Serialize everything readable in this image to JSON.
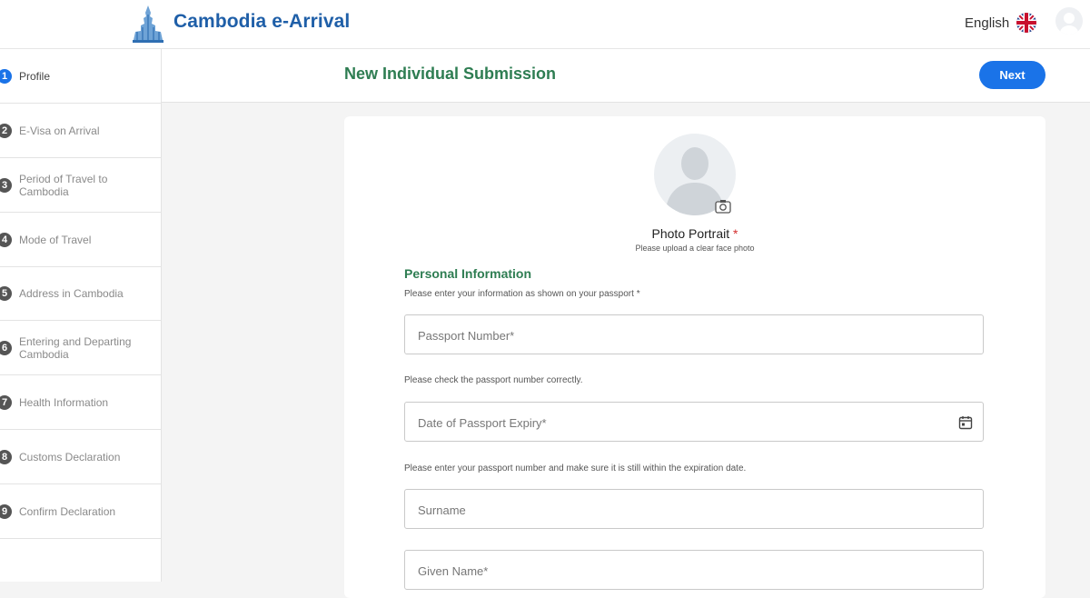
{
  "header": {
    "brand": "Cambodia e-Arrival",
    "language": "English",
    "icons": {
      "logo": "angkor-logo-icon",
      "flag": "uk-flag-icon",
      "user": "user-avatar-icon"
    }
  },
  "sidebar": {
    "steps": [
      {
        "number": "1",
        "label": "Profile",
        "active": true
      },
      {
        "number": "2",
        "label": "E-Visa on Arrival"
      },
      {
        "number": "3",
        "label": "Period of Travel to Cambodia"
      },
      {
        "number": "4",
        "label": "Mode of Travel"
      },
      {
        "number": "5",
        "label": "Address in Cambodia"
      },
      {
        "number": "6",
        "label": "Entering and Departing Cambodia"
      },
      {
        "number": "7",
        "label": "Health Information"
      },
      {
        "number": "8",
        "label": "Customs Declaration"
      },
      {
        "number": "9",
        "label": "Confirm Declaration"
      }
    ]
  },
  "main": {
    "title": "New Individual Submission",
    "next_label": "Next",
    "photo": {
      "title": "Photo Portrait",
      "required_mark": "*",
      "hint": "Please upload a clear face photo"
    },
    "personal": {
      "title": "Personal Information",
      "note": "Please enter your information as shown on your passport *"
    },
    "fields": {
      "passport_number": {
        "placeholder": "Passport Number*",
        "value": ""
      },
      "passport_hint": "Please check the passport number correctly.",
      "passport_expiry": {
        "placeholder": "Date of Passport Expiry*",
        "value": ""
      },
      "expiry_hint": "Please enter your passport number and make sure it is still within the expiration date.",
      "surname": {
        "placeholder": "Surname",
        "value": ""
      },
      "given_name": {
        "placeholder": "Given Name*",
        "value": ""
      }
    }
  },
  "colors": {
    "brand": "#1f5fa8",
    "accent": "#1a73e8",
    "section_green": "#2e7d52",
    "required_red": "#d32f2f"
  }
}
